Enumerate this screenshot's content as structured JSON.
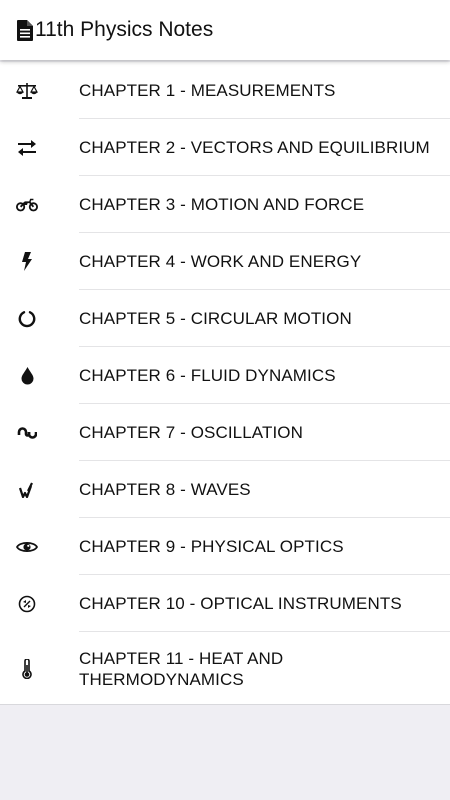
{
  "app_bar": {
    "title": "11th Physics Notes",
    "icon": "document-icon"
  },
  "chapters": [
    {
      "label": "CHAPTER 1 - MEASUREMENTS",
      "icon": "balance-scale-icon"
    },
    {
      "label": "CHAPTER 2 - VECTORS AND EQUILIBRIUM",
      "icon": "exchange-arrows-icon"
    },
    {
      "label": "CHAPTER 3 - MOTION AND FORCE",
      "icon": "motorcycle-icon"
    },
    {
      "label": "CHAPTER 4 - WORK AND ENERGY",
      "icon": "lightning-bolt-icon"
    },
    {
      "label": "CHAPTER 5 - CIRCULAR MOTION",
      "icon": "circle-notch-icon"
    },
    {
      "label": "CHAPTER 6 - FLUID DYNAMICS",
      "icon": "water-drop-icon"
    },
    {
      "label": "CHAPTER 7 - OSCILLATION",
      "icon": "stumbleupon-icon"
    },
    {
      "label": "CHAPTER 8 - WAVES",
      "icon": "waves-icon"
    },
    {
      "label": "CHAPTER 9 - PHYSICAL OPTICS",
      "icon": "eye-icon"
    },
    {
      "label": "CHAPTER 10 - OPTICAL INSTRUMENTS",
      "icon": "camera-lens-icon"
    },
    {
      "label": "CHAPTER 11 - HEAT AND THERMODYNAMICS",
      "icon": "thermometer-icon"
    }
  ]
}
